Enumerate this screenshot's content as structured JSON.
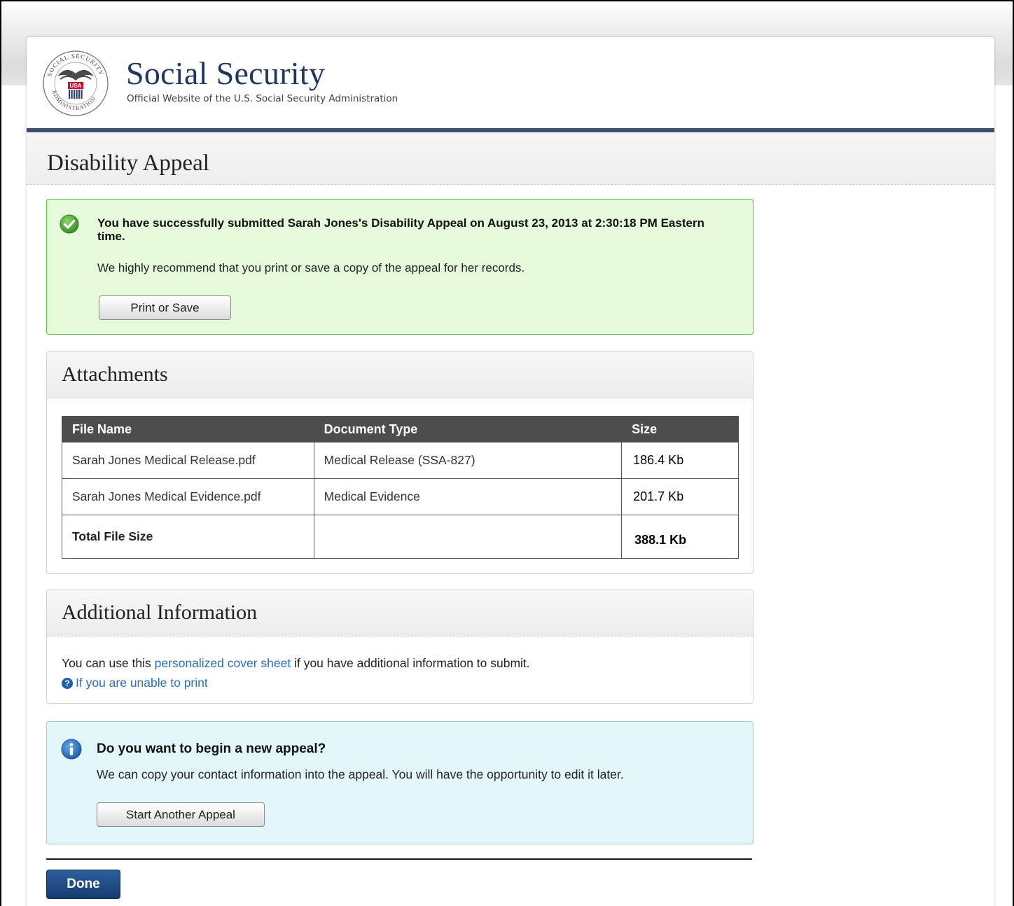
{
  "header": {
    "brand_title": "Social Security",
    "brand_subtitle": "Official Website of the U.S. Social Security Administration",
    "seal_text": "SOCIAL SECURITY ADMINISTRATION USA",
    "colors": {
      "brand_blue": "#1f3660",
      "header_bar": "#3d4e6e"
    }
  },
  "page": {
    "title": "Disability Appeal"
  },
  "success_alert": {
    "icon": "check-circle-icon",
    "title": "You have successfully submitted Sarah Jones's Disability Appeal on August 23, 2013 at 2:30:18 PM Eastern time.",
    "message": "We highly recommend that you print or save a copy of the appeal for her records.",
    "button_label": "Print or Save",
    "colors": {
      "background": "#e5fad9",
      "border": "#5cb84a"
    }
  },
  "attachments": {
    "title": "Attachments",
    "columns": [
      "File Name",
      "Document Type",
      "Size"
    ],
    "rows": [
      {
        "file_name": "Sarah Jones Medical Release.pdf",
        "document_type": "Medical Release (SSA-827)",
        "size": "186.4 Kb"
      },
      {
        "file_name": "Sarah Jones Medical Evidence.pdf",
        "document_type": "Medical Evidence",
        "size": "201.7 Kb"
      }
    ],
    "total_label": "Total File Size",
    "total_size": "388.1 Kb"
  },
  "additional_info": {
    "title": "Additional Information",
    "text_before": "You can use this ",
    "link_text": "personalized cover sheet",
    "text_after": " if you have additional information to submit.",
    "help_icon": "question-circle-icon",
    "help_link": "If you are unable to print"
  },
  "info_alert": {
    "icon": "info-circle-icon",
    "title": "Do you want to begin a new appeal?",
    "message": "We can copy your contact information into the appeal. You will have the opportunity to edit it later.",
    "button_label": "Start Another Appeal",
    "colors": {
      "background": "#e3f6f9",
      "border": "#a9c7d2"
    }
  },
  "footer": {
    "done_label": "Done"
  }
}
